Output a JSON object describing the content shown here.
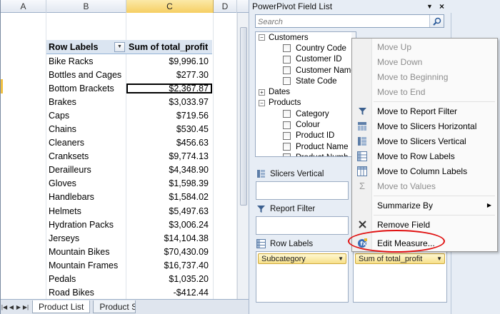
{
  "excel": {
    "columns": [
      {
        "letter": "A",
        "width": 64,
        "selected": false
      },
      {
        "letter": "B",
        "width": 112,
        "selected": false
      },
      {
        "letter": "C",
        "width": 122,
        "selected": true
      },
      {
        "letter": "D",
        "width": 33,
        "selected": false
      }
    ],
    "pivot": {
      "header_label": "Row Labels",
      "header_value": "Sum of total_profit",
      "rows": [
        {
          "label": "Bike Racks",
          "value": "$9,996.10"
        },
        {
          "label": "Bottles and Cages",
          "value": "$277.30"
        },
        {
          "label": "Bottom Brackets",
          "value": "$2,367.87"
        },
        {
          "label": "Brakes",
          "value": "$3,033.97"
        },
        {
          "label": "Caps",
          "value": "$719.56"
        },
        {
          "label": "Chains",
          "value": "$530.45"
        },
        {
          "label": "Cleaners",
          "value": "$456.63"
        },
        {
          "label": "Cranksets",
          "value": "$9,774.13"
        },
        {
          "label": "Derailleurs",
          "value": "$4,348.90"
        },
        {
          "label": "Gloves",
          "value": "$1,598.39"
        },
        {
          "label": "Handlebars",
          "value": "$1,584.02"
        },
        {
          "label": "Helmets",
          "value": "$5,497.63"
        },
        {
          "label": "Hydration Packs",
          "value": "$3,006.24"
        },
        {
          "label": "Jerseys",
          "value": "$14,104.38"
        },
        {
          "label": "Mountain Bikes",
          "value": "$70,430.09"
        },
        {
          "label": "Mountain Frames",
          "value": "$16,737.40"
        },
        {
          "label": "Pedals",
          "value": "$1,035.20"
        },
        {
          "label": "Road Bikes",
          "value": "-$412.44"
        }
      ]
    },
    "sheet_tabs": [
      "Product List",
      "Product S"
    ]
  },
  "panel": {
    "title": "PowerPivot Field List",
    "search_placeholder": "Search",
    "tree": [
      {
        "type": "table",
        "label": "Customers",
        "expander": "−"
      },
      {
        "type": "field",
        "label": "Country Code"
      },
      {
        "type": "field",
        "label": "Customer ID"
      },
      {
        "type": "field",
        "label": "Customer Name"
      },
      {
        "type": "field",
        "label": "State Code"
      },
      {
        "type": "table",
        "label": "Dates",
        "expander": "+"
      },
      {
        "type": "table",
        "label": "Products",
        "expander": "−"
      },
      {
        "type": "field",
        "label": "Category"
      },
      {
        "type": "field",
        "label": "Colour"
      },
      {
        "type": "field",
        "label": "Product ID"
      },
      {
        "type": "field",
        "label": "Product Name"
      },
      {
        "type": "field",
        "label": "Product Numb"
      }
    ],
    "zones": {
      "slicers_vertical": "Slicers Vertical",
      "report_filter": "Report Filter",
      "row_labels": "Row Labels",
      "row_chip": "Subcategory",
      "value_chip": "Sum of total_profit"
    }
  },
  "context_menu": {
    "items": [
      {
        "label": "Move Up",
        "enabled": false,
        "icon": ""
      },
      {
        "label": "Move Down",
        "enabled": false,
        "icon": ""
      },
      {
        "label": "Move to Beginning",
        "enabled": false,
        "icon": ""
      },
      {
        "label": "Move to End",
        "enabled": false,
        "icon": ""
      },
      {
        "label": "Move to Report Filter",
        "enabled": true,
        "icon": "filter-icon"
      },
      {
        "label": "Move to Slicers Horizontal",
        "enabled": true,
        "icon": "slicers-horizontal-icon"
      },
      {
        "label": "Move to Slicers Vertical",
        "enabled": true,
        "icon": "slicers-vertical-icon"
      },
      {
        "label": "Move to Row Labels",
        "enabled": true,
        "icon": "row-labels-icon"
      },
      {
        "label": "Move to Column Labels",
        "enabled": true,
        "icon": "column-labels-icon"
      },
      {
        "label": "Move to Values",
        "enabled": false,
        "icon": "sigma-icon"
      },
      {
        "label": "Summarize By",
        "enabled": true,
        "icon": "",
        "submenu": true
      },
      {
        "label": "Remove Field",
        "enabled": true,
        "icon": "remove-icon"
      },
      {
        "label": "Edit Measure...",
        "enabled": true,
        "icon": "edit-measure-icon"
      }
    ]
  },
  "colors": {
    "highlight_ring": "#e01010",
    "pivot_header_bg": "#dbe5f1",
    "chip_bg": "#f7e08a",
    "selected_column": "#f6cf63"
  }
}
